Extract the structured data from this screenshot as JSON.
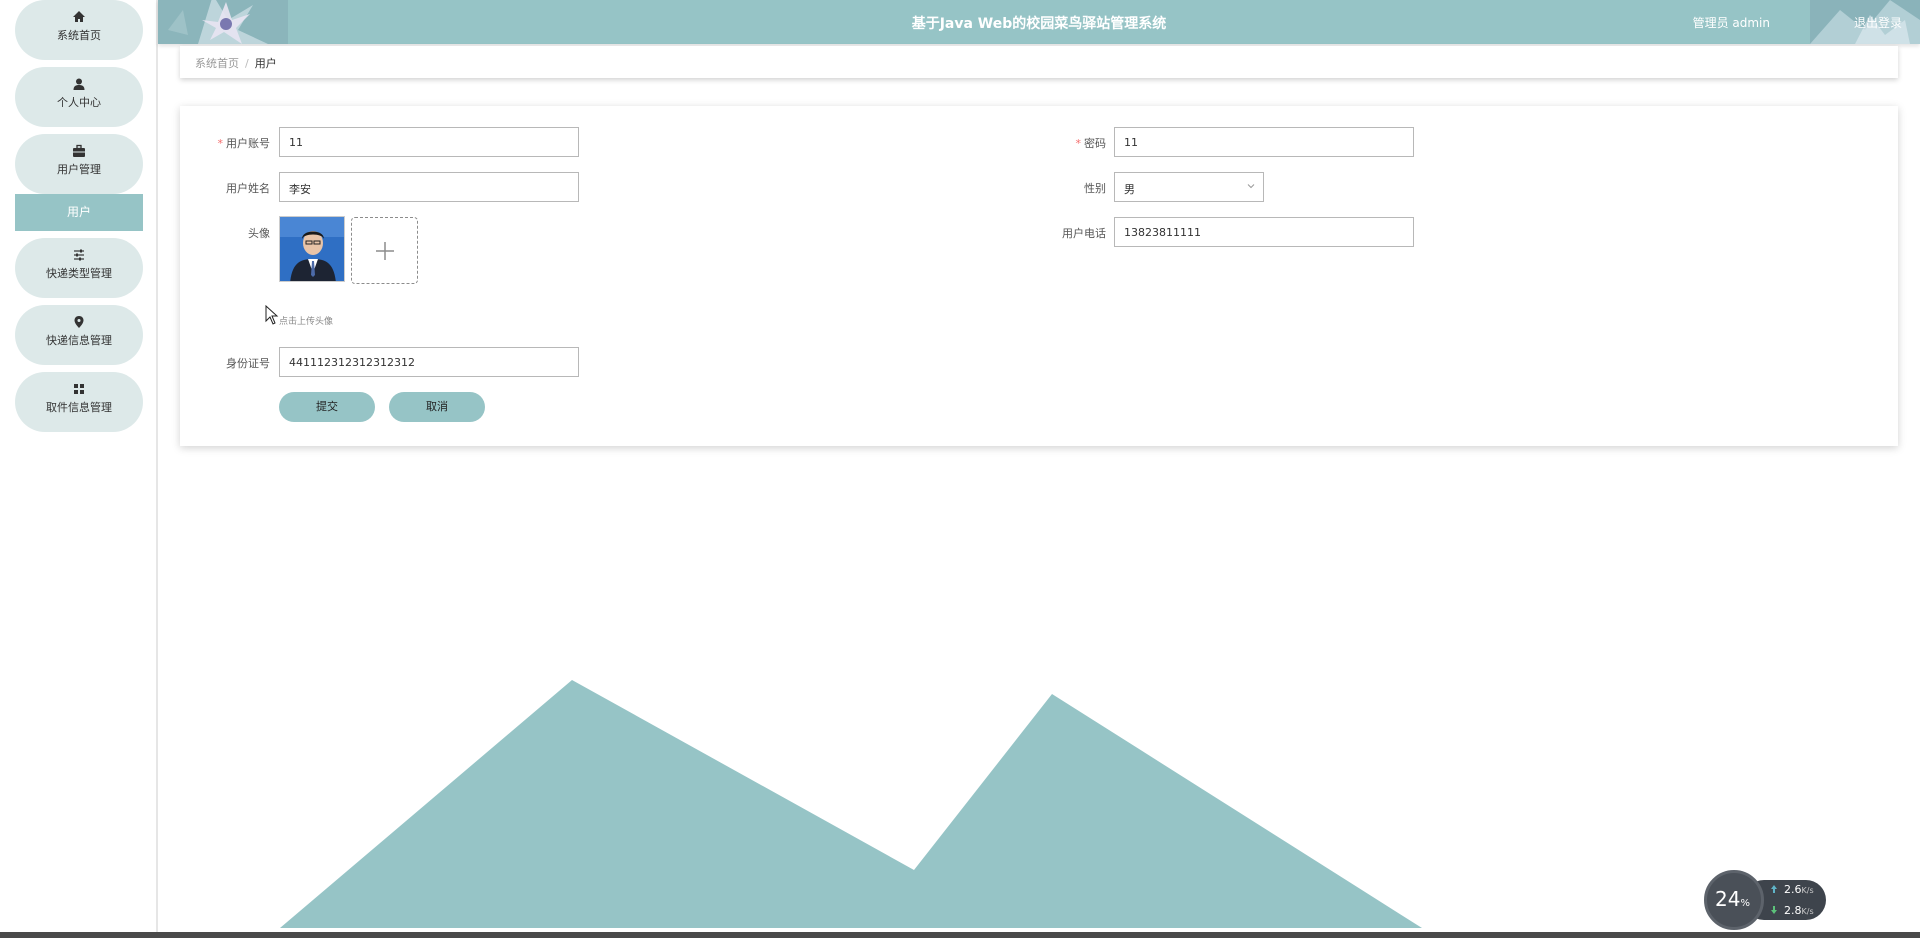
{
  "app": {
    "title": "基于Java Web的校园菜鸟驿站管理系统",
    "user_label": "管理员 admin",
    "logout_label": "退出登录"
  },
  "sidebar": {
    "items": [
      {
        "label": "系统首页",
        "icon": "home-icon"
      },
      {
        "label": "个人中心",
        "icon": "user-icon"
      },
      {
        "label": "用户管理",
        "icon": "briefcase-icon"
      },
      {
        "label": "快递类型管理",
        "icon": "sliders-icon"
      },
      {
        "label": "快递信息管理",
        "icon": "location-pin-icon"
      },
      {
        "label": "取件信息管理",
        "icon": "grid-icon"
      }
    ],
    "submenu": {
      "label": "用户"
    }
  },
  "breadcrumb": {
    "home": "系统首页",
    "separator": "/",
    "current": "用户"
  },
  "form": {
    "account_label": "用户账号",
    "account_value": "11",
    "password_label": "密码",
    "password_value": "11",
    "name_label": "用户姓名",
    "name_value": "李安",
    "gender_label": "性别",
    "gender_value": "男",
    "avatar_label": "头像",
    "phone_label": "用户电话",
    "phone_value": "13823811111",
    "upload_hint": "点击上传头像",
    "idcard_label": "身份证号",
    "idcard_value": "441112312312312312",
    "required_mark": "*",
    "submit_label": "提交",
    "cancel_label": "取消"
  },
  "speed_widget": {
    "percent": "24",
    "percent_unit": "%",
    "upload": "2.6",
    "download": "2.8",
    "unit": "K/s"
  },
  "colors": {
    "primary": "#96c4c6",
    "menu_bg": "#dde9e9",
    "required": "#f56c6c"
  }
}
